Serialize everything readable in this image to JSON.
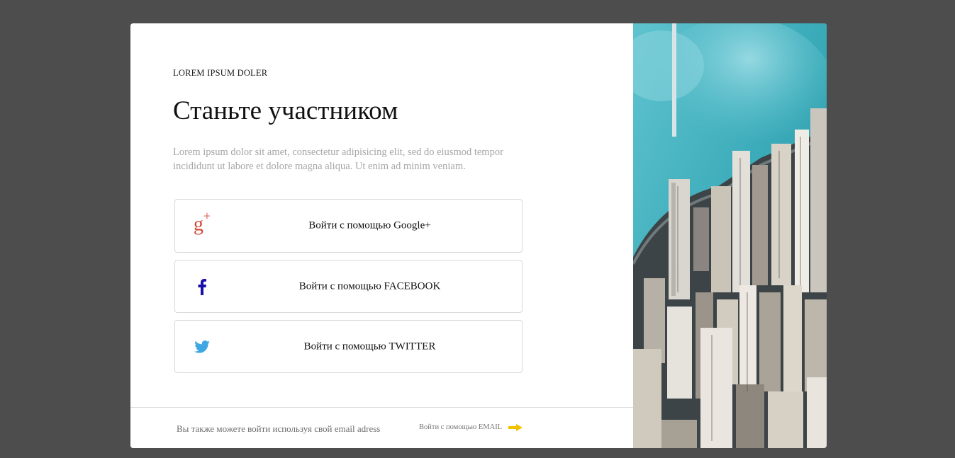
{
  "modal": {
    "eyebrow": "LOREM IPSUM DOLER",
    "title": "Станьте участником",
    "description": "Lorem ipsum dolor sit amet, consectetur adipisicing elit, sed do eiusmod tempor incididunt ut labore et dolore magna aliqua. Ut enim ad minim veniam.",
    "buttons": [
      {
        "label": "Войти с помощью Google+",
        "icon": "google-plus-icon",
        "color": "#d34836"
      },
      {
        "label": "Войти с помощью FACEBOOK",
        "icon": "facebook-icon",
        "color": "#1a0fa8"
      },
      {
        "label": "Войти с помощью TWITTER",
        "icon": "twitter-icon",
        "color": "#3ea6e3"
      }
    ],
    "footer": {
      "text": "Вы также можете войти используя свой email adress",
      "email_link": "Войти с помощью EMAIL",
      "arrow_color": "#f2c200"
    },
    "image": "city-aerial-image"
  }
}
